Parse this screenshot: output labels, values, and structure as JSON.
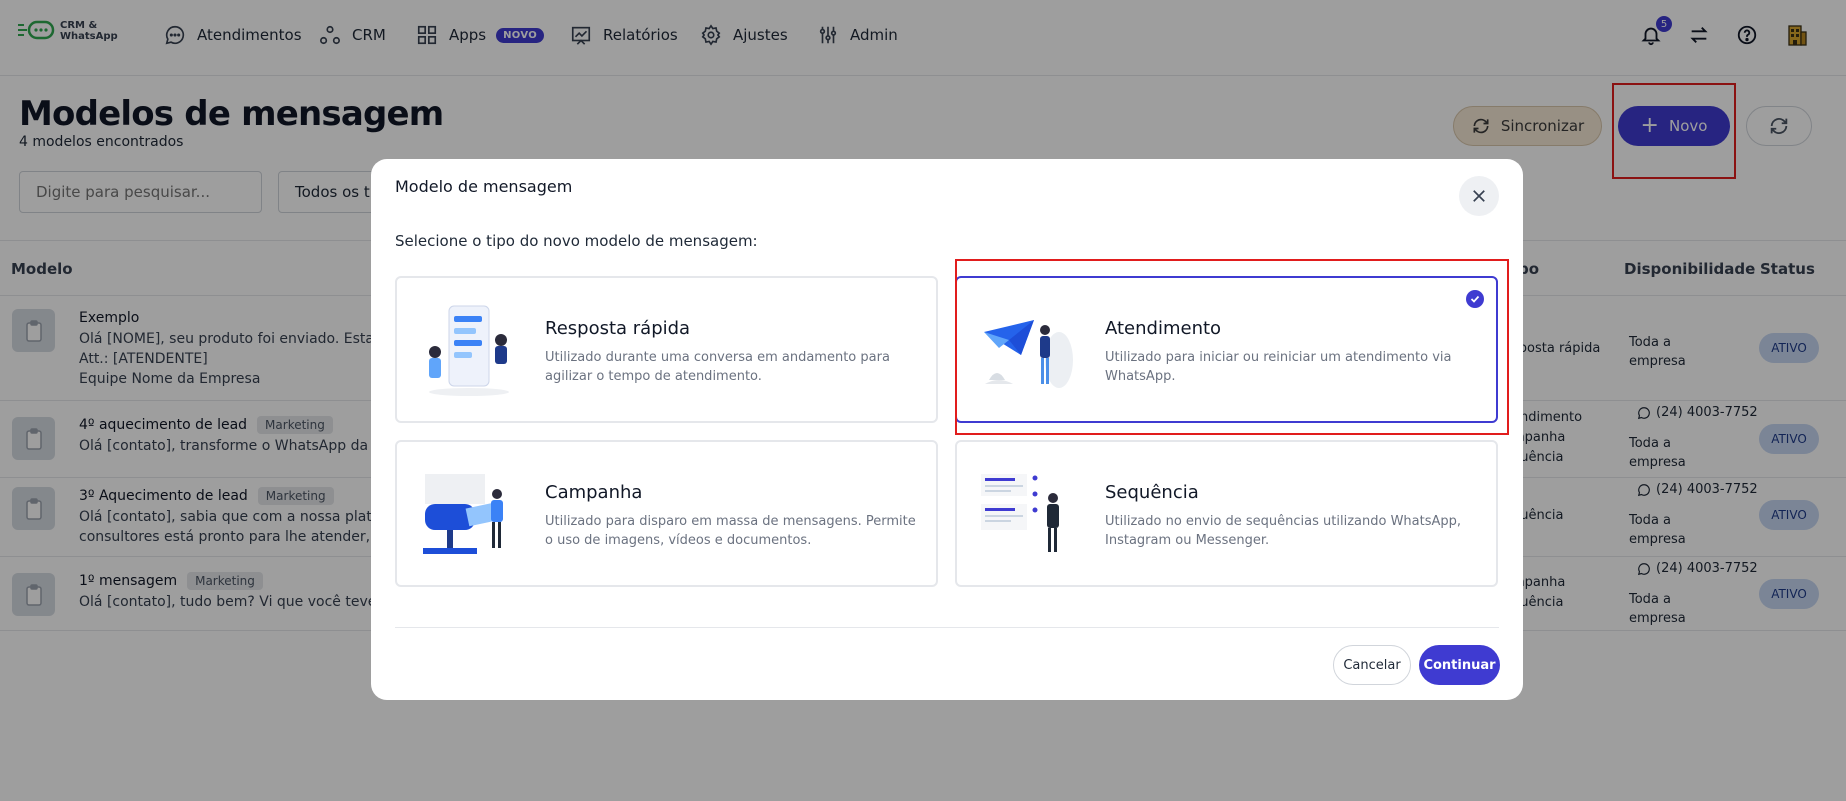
{
  "brand": {
    "line1": "CRM &",
    "line2": "WhatsApp"
  },
  "nav": {
    "items": [
      {
        "label": "Atendimentos",
        "icon": "chat-icon"
      },
      {
        "label": "CRM",
        "icon": "crm-icon"
      },
      {
        "label": "Apps",
        "icon": "apps-grid-icon",
        "badge": "NOVO"
      },
      {
        "label": "Relatórios",
        "icon": "reports-icon"
      },
      {
        "label": "Ajustes",
        "icon": "gear-icon"
      },
      {
        "label": "Admin",
        "icon": "sliders-icon"
      }
    ],
    "notifications_count": "5"
  },
  "page": {
    "title": "Modelos de mensagem",
    "subtitle": "4 modelos encontrados",
    "sync_label": "Sincronizar",
    "new_label": "Novo",
    "search_placeholder": "Digite para pesquisar...",
    "type_filter": "Todos os tipos"
  },
  "table": {
    "headers": {
      "modelo": "Modelo",
      "tipo": "po",
      "disponibilidade": "Disponibilidade",
      "status": "Status"
    },
    "rows": [
      {
        "title": "Exemplo",
        "tag": "",
        "lines": [
          "Olá [NOME], seu produto foi enviado. Estam",
          "Att.: [ATENDENTE]",
          "Equipe Nome da Empresa"
        ],
        "type_lines": [
          "sposta rápida"
        ],
        "phone": "",
        "avail": [
          "Toda a",
          "empresa"
        ],
        "status": "ATIVO"
      },
      {
        "title": "4º aquecimento de lead",
        "tag": "Marketing",
        "lines": [
          "Olá [contato], transforme o WhatsApp da su"
        ],
        "type_lines": [
          "endimento",
          "mpanha",
          "quência"
        ],
        "phone": "(24) 4003-7752",
        "avail": [
          "Toda a",
          "empresa"
        ],
        "status": "ATIVO"
      },
      {
        "title": "3º Aquecimento de lead",
        "tag": "Marketing",
        "lines": [
          "Olá [contato], sabia que com a nossa plataf",
          "consultores está pronto para lhe atender, po"
        ],
        "type_lines": [
          "quência"
        ],
        "phone": "(24) 4003-7752",
        "avail": [
          "Toda a",
          "empresa"
        ],
        "status": "ATIVO"
      },
      {
        "title": "1º mensagem",
        "tag": "Marketing",
        "lines": [
          "Olá [contato], tudo bem? Vi que você teve in"
        ],
        "type_lines": [
          "mpanha",
          "quência"
        ],
        "phone": "(24) 4003-7752",
        "avail": [
          "Toda a",
          "empresa"
        ],
        "status": "ATIVO"
      }
    ]
  },
  "modal": {
    "title": "Modelo de mensagem",
    "prompt": "Selecione o tipo do novo modelo de mensagem:",
    "options": [
      {
        "title": "Resposta rápida",
        "desc": "Utilizado durante uma conversa em andamento para agilizar o tempo de atendimento.",
        "selected": false
      },
      {
        "title": "Atendimento",
        "desc": "Utilizado para iniciar ou reiniciar um atendimento via WhatsApp.",
        "selected": true
      },
      {
        "title": "Campanha",
        "desc": "Utilizado para disparo em massa de mensagens. Permite o uso de imagens, vídeos e documentos.",
        "selected": false
      },
      {
        "title": "Sequência",
        "desc": "Utilizado no envio de sequências utilizando WhatsApp, Instagram ou Messenger.",
        "selected": false
      }
    ],
    "cancel_label": "Cancelar",
    "continue_label": "Continuar"
  },
  "colors": {
    "accent": "#3f3bd1",
    "highlight": "#e11d1d",
    "sync_bg": "#f6e9d6",
    "status_bg": "#c7d7f2"
  }
}
